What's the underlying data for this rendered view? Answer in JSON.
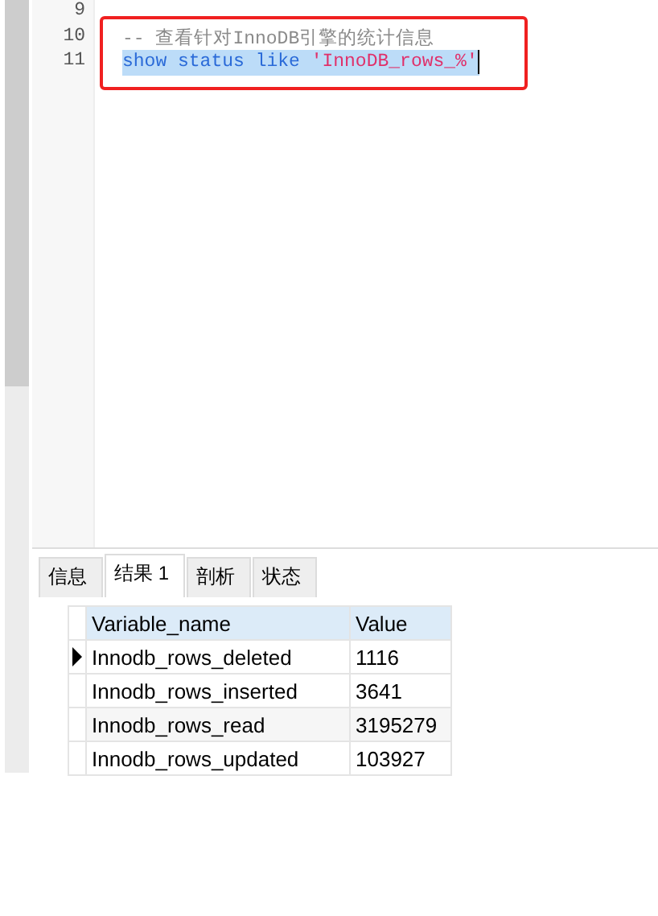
{
  "editor": {
    "lines": [
      {
        "number": "9",
        "selected": false
      },
      {
        "number": "10",
        "selected": false,
        "tokens": [
          {
            "kind": "comment",
            "text": "-- 查看针对InnoDB引擎的统计信息"
          }
        ]
      },
      {
        "number": "11",
        "selected": true,
        "tokens": [
          {
            "kind": "keyword",
            "text": "show status like "
          },
          {
            "kind": "string",
            "text": "'InnoDB_rows_%'"
          }
        ]
      }
    ]
  },
  "tabs": [
    {
      "label": "信息",
      "selected": false
    },
    {
      "label": "结果 1",
      "selected": true
    },
    {
      "label": "剖析",
      "selected": false
    },
    {
      "label": "状态",
      "selected": false
    }
  ],
  "table": {
    "columns": [
      "Variable_name",
      "Value"
    ],
    "rows": [
      {
        "cells": [
          "Innodb_rows_deleted",
          "1116"
        ],
        "selected": true
      },
      {
        "cells": [
          "Innodb_rows_inserted",
          "3641"
        ],
        "selected": false
      },
      {
        "cells": [
          "Innodb_rows_read",
          "3195279"
        ],
        "selected": false
      },
      {
        "cells": [
          "Innodb_rows_updated",
          "103927"
        ],
        "selected": false
      }
    ]
  }
}
